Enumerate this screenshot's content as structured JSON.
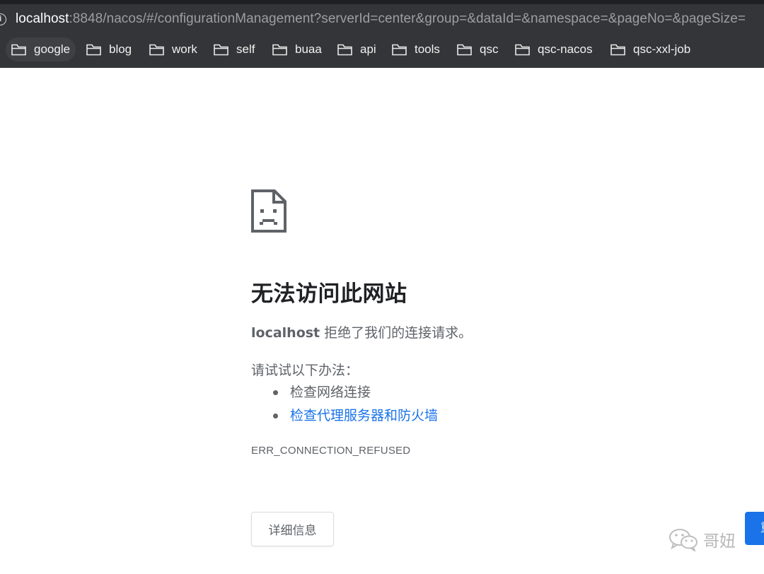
{
  "browser": {
    "url_host": "localhost",
    "url_rest": ":8848/nacos/#/configurationManagement?serverId=center&group=&dataId=&namespace=&pageNo=&pageSize=",
    "bookmarks": [
      {
        "label": "google",
        "icon": "folder-icon"
      },
      {
        "label": "blog",
        "icon": "folder-icon"
      },
      {
        "label": "work",
        "icon": "folder-icon"
      },
      {
        "label": "self",
        "icon": "folder-icon"
      },
      {
        "label": "buaa",
        "icon": "folder-icon"
      },
      {
        "label": "api",
        "icon": "folder-icon"
      },
      {
        "label": "tools",
        "icon": "folder-icon"
      },
      {
        "label": "qsc",
        "icon": "folder-icon"
      },
      {
        "label": "qsc-nacos",
        "icon": "folder-icon"
      },
      {
        "label": "qsc-xxl-job",
        "icon": "folder-icon"
      }
    ]
  },
  "error_page": {
    "icon": "sad-page-icon",
    "title": "无法访问此网站",
    "host": "localhost",
    "message": " 拒绝了我们的连接请求。",
    "try_label": "请试试以下办法：",
    "suggestions": [
      {
        "text": "检查网络连接",
        "is_link": false
      },
      {
        "text": "检查代理服务器和防火墙",
        "is_link": true
      }
    ],
    "error_code": "ERR_CONNECTION_REFUSED",
    "details_button": "详细信息",
    "right_button": "重"
  },
  "watermark": {
    "icon": "wechat-icon",
    "text": "哥妞"
  },
  "colors": {
    "chrome_bg": "#343538",
    "link": "#1a73e8",
    "text": "#5f6368",
    "title": "#202124"
  }
}
